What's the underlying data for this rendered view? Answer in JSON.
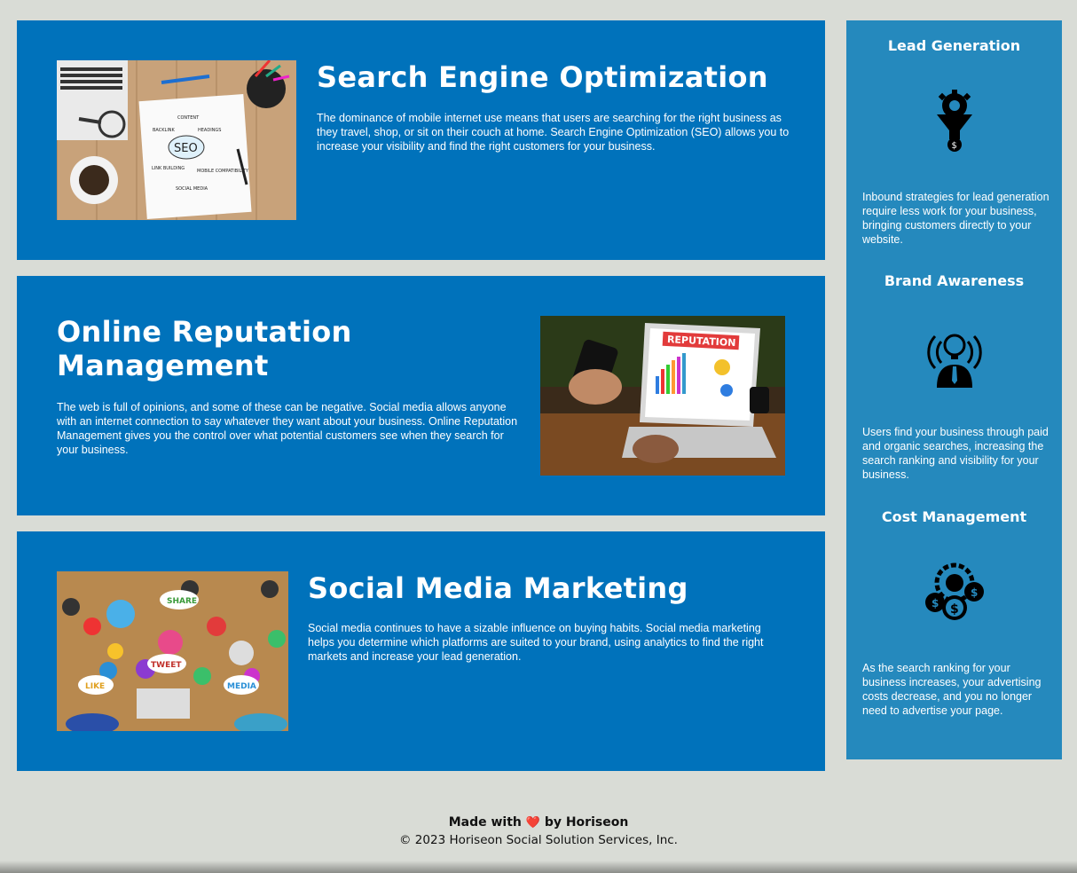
{
  "sections": [
    {
      "title": "Search Engine Optimization",
      "text": "The dominance of mobile internet use means that users are searching for the right business as they travel, shop, or sit on their couch at home. Search Engine Optimization (SEO) allows you to increase your visibility and find the right customers for your business.",
      "image_words": [
        "SEO",
        "BACKLINK",
        "CONTENT",
        "HEADINGS",
        "LINK BUILDING",
        "MOBILE COMPATIBILITY",
        "SOCIAL MEDIA"
      ]
    },
    {
      "title": "Online Reputation Management",
      "text": "The web is full of opinions, and some of these can be negative. Social media allows anyone with an internet connection to say whatever they want about your business. Online Reputation Management gives you the control over what potential customers see when they search for your business.",
      "image_words": [
        "REPUTATION"
      ]
    },
    {
      "title": "Social Media Marketing",
      "text": "Social media continues to have a sizable influence on buying habits. Social media marketing helps you determine which platforms are suited to your brand, using analytics to find the right markets and increase your lead generation.",
      "image_words": [
        "SHARE",
        "TWEET",
        "LIKE",
        "MEDIA"
      ]
    }
  ],
  "benefits": [
    {
      "title": "Lead Generation",
      "icon": "lead-funnel-icon",
      "text": "Inbound strategies for lead generation require less work for your business, bringing customers directly to your website."
    },
    {
      "title": "Brand Awareness",
      "icon": "brand-lightbulb-icon",
      "text": "Users find your business through paid and organic searches, increasing the search ranking and visibility for your business."
    },
    {
      "title": "Cost Management",
      "icon": "cost-gear-icon",
      "text": "As the search ranking for your business increases, your advertising costs decrease, and you no longer need to advertise your page."
    }
  ],
  "footer": {
    "made_prefix": "Made with",
    "heart": "❤️",
    "made_suffix": "by Horiseon",
    "copyright": "© 2023 Horiseon Social Solution Services, Inc."
  },
  "colors": {
    "card_bg": "#0072bb",
    "benefits_bg": "#2589bd",
    "page_bg": "#d9dcd6"
  }
}
